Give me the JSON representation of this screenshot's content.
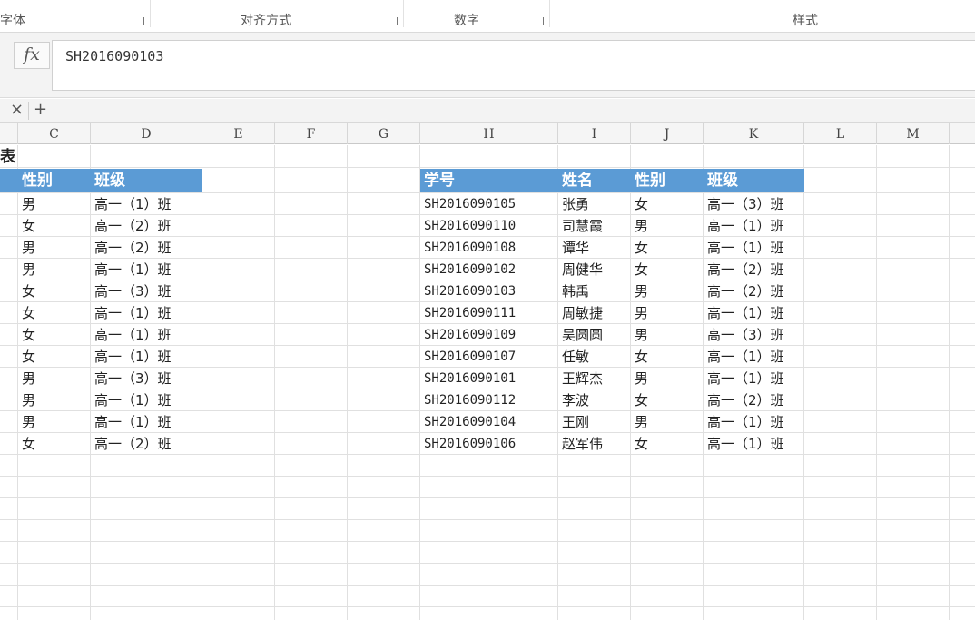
{
  "ribbon": {
    "groups": [
      {
        "label": "字体"
      },
      {
        "label": "对齐方式"
      },
      {
        "label": "数字"
      },
      {
        "label": "样式"
      }
    ]
  },
  "formula_bar": {
    "fx_label": "fx",
    "value": "SH2016090103"
  },
  "tabs": {
    "close_symbol": "×",
    "add_symbol": "+"
  },
  "columns": [
    "C",
    "D",
    "E",
    "F",
    "G",
    "H",
    "I",
    "J",
    "K",
    "L",
    "M"
  ],
  "left_table": {
    "title": "表",
    "headers": [
      "性别",
      "班级"
    ],
    "rows": [
      [
        "男",
        "高一（1）班"
      ],
      [
        "女",
        "高一（2）班"
      ],
      [
        "男",
        "高一（2）班"
      ],
      [
        "男",
        "高一（1）班"
      ],
      [
        "女",
        "高一（3）班"
      ],
      [
        "女",
        "高一（1）班"
      ],
      [
        "女",
        "高一（1）班"
      ],
      [
        "女",
        "高一（1）班"
      ],
      [
        "男",
        "高一（3）班"
      ],
      [
        "男",
        "高一（1）班"
      ],
      [
        "男",
        "高一（1）班"
      ],
      [
        "女",
        "高一（2）班"
      ]
    ]
  },
  "right_table": {
    "headers": [
      "学号",
      "姓名",
      "性别",
      "班级"
    ],
    "rows": [
      [
        "SH2016090105",
        "张勇",
        "女",
        "高一（3）班"
      ],
      [
        "SH2016090110",
        "司慧霞",
        "男",
        "高一（1）班"
      ],
      [
        "SH2016090108",
        "谭华",
        "女",
        "高一（1）班"
      ],
      [
        "SH2016090102",
        "周健华",
        "女",
        "高一（2）班"
      ],
      [
        "SH2016090103",
        "韩禹",
        "男",
        "高一（2）班"
      ],
      [
        "SH2016090111",
        "周敏捷",
        "男",
        "高一（1）班"
      ],
      [
        "SH2016090109",
        "吴圆圆",
        "男",
        "高一（3）班"
      ],
      [
        "SH2016090107",
        "任敏",
        "女",
        "高一（1）班"
      ],
      [
        "SH2016090101",
        "王辉杰",
        "男",
        "高一（1）班"
      ],
      [
        "SH2016090112",
        "李波",
        "女",
        "高一（2）班"
      ],
      [
        "SH2016090104",
        "王刚",
        "男",
        "高一（1）班"
      ],
      [
        "SH2016090106",
        "赵军伟",
        "女",
        "高一（1）班"
      ]
    ]
  },
  "colors": {
    "header_fill": "#5b9bd5",
    "header_text": "#ffffff",
    "grid_line": "#e0e0e0"
  }
}
